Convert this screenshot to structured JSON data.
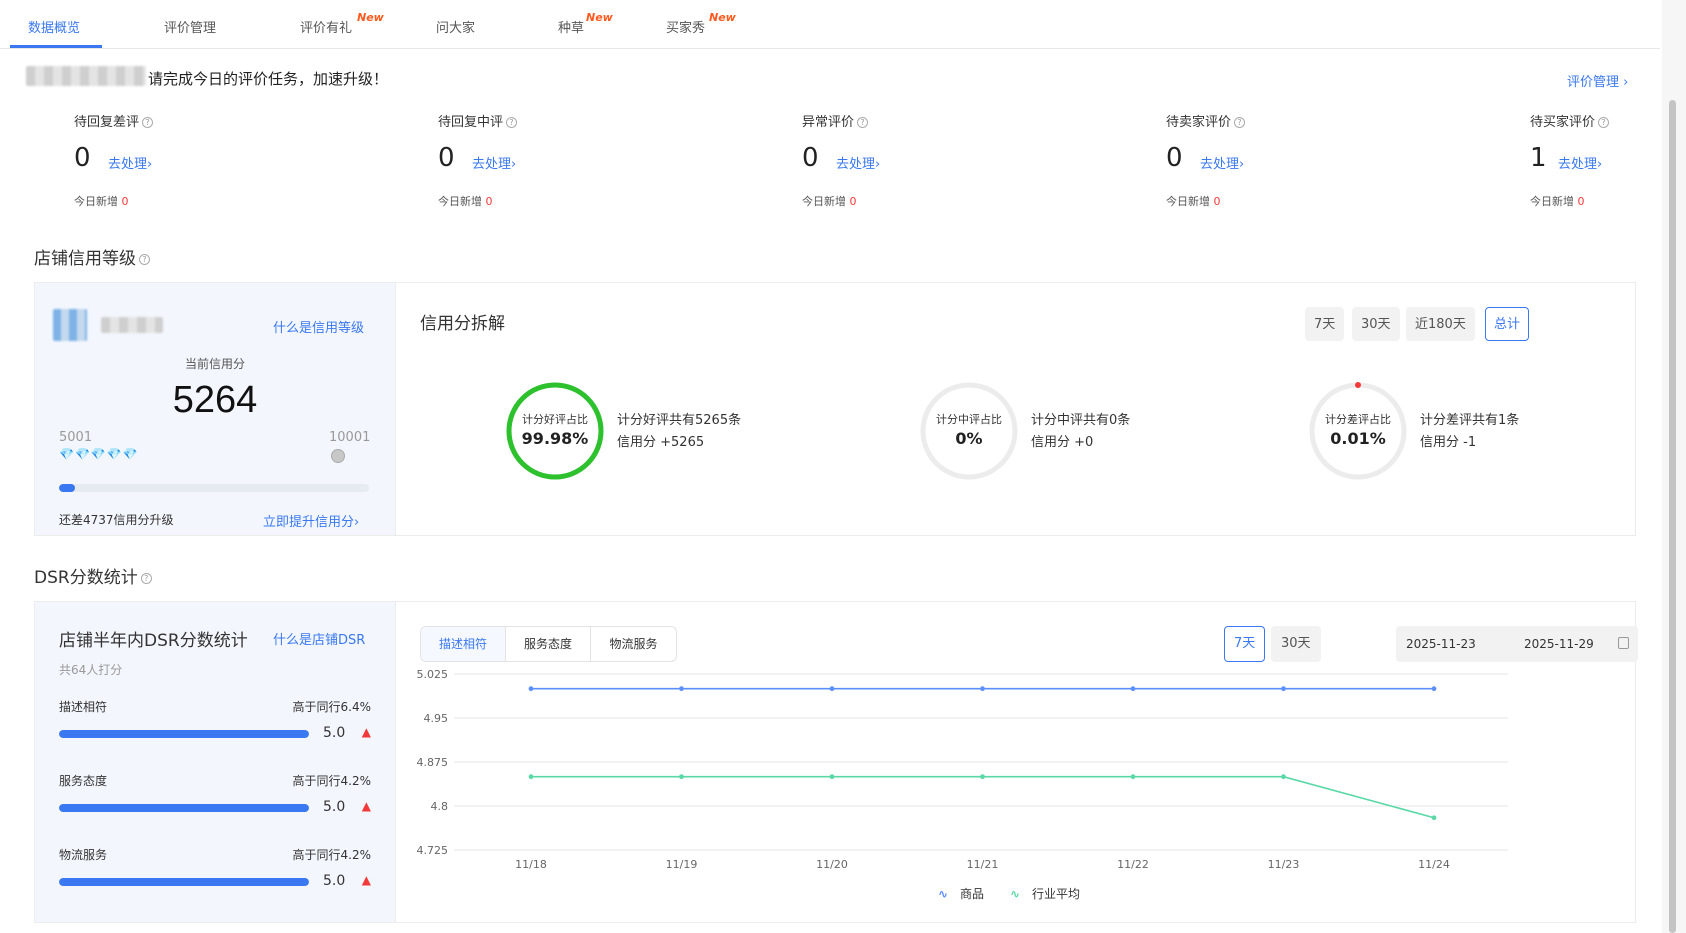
{
  "tabs": [
    {
      "label": "数据概览",
      "badge": ""
    },
    {
      "label": "评价管理",
      "badge": ""
    },
    {
      "label": "评价有礼",
      "badge": "New"
    },
    {
      "label": "问大家",
      "badge": ""
    },
    {
      "label": "种草",
      "badge": "New"
    },
    {
      "label": "买家秀",
      "badge": "New"
    }
  ],
  "notice": {
    "text": "请完成今日的评价任务，加速升级！",
    "review_manage_link": "评价管理 ›"
  },
  "metrics": [
    {
      "label": "待回复差评",
      "value": "0",
      "action": "去处理›",
      "new_label": "今日新增",
      "new_count": "0"
    },
    {
      "label": "待回复中评",
      "value": "0",
      "action": "去处理›",
      "new_label": "今日新增",
      "new_count": "0"
    },
    {
      "label": "异常评价",
      "value": "0",
      "action": "去处理›",
      "new_label": "今日新增",
      "new_count": "0"
    },
    {
      "label": "待卖家评价",
      "value": "0",
      "action": "去处理›",
      "new_label": "今日新增",
      "new_count": "0"
    },
    {
      "label": "待买家评价",
      "value": "1",
      "action": "去处理›",
      "new_label": "今日新增",
      "new_count": "0"
    }
  ],
  "credit": {
    "section_title": "店铺信用等级",
    "what_link": "什么是信用等级",
    "current_label": "当前信用分",
    "current_value": "5264",
    "range_min": "5001",
    "range_max": "10001",
    "level_icons": "💎💎💎💎💎",
    "progress_fraction": 0.0526,
    "gap_text": "还差4737信用分升级",
    "raise_link": "立即提升信用分›",
    "breakdown_title": "信用分拆解",
    "periods": [
      "7天",
      "30天",
      "近180天",
      "总计"
    ],
    "active_period": "总计",
    "rings": [
      {
        "caption": "计分好评占比",
        "percent": "99.98%",
        "fraction": 0.9998,
        "desc": "计分好评共有5265条",
        "score": "信用分 +5265",
        "color": "#2dc12d"
      },
      {
        "caption": "计分中评占比",
        "percent": "0%",
        "fraction": 0,
        "desc": "计分中评共有0条",
        "score": "信用分 +0",
        "color": "#f5a623"
      },
      {
        "caption": "计分差评占比",
        "percent": "0.01%",
        "fraction": 0.0001,
        "desc": "计分差评共有1条",
        "score": "信用分 -1",
        "color": "#f23a3a"
      }
    ]
  },
  "dsr": {
    "section_title": "DSR分数统计",
    "title": "店铺半年内DSR分数统计",
    "what_link": "什么是店铺DSR",
    "rater_count": "共64人打分",
    "rows": [
      {
        "name": "描述相符",
        "compare": "高于同行6.4%",
        "score": "5.0",
        "fraction": 1.0
      },
      {
        "name": "服务态度",
        "compare": "高于同行4.2%",
        "score": "5.0",
        "fraction": 1.0
      },
      {
        "name": "物流服务",
        "compare": "高于同行4.2%",
        "score": "5.0",
        "fraction": 1.0
      }
    ],
    "segments": [
      "描述相符",
      "服务态度",
      "物流服务"
    ],
    "active_segment": "描述相符",
    "periods": [
      "7天",
      "30天"
    ],
    "active_period": "7天",
    "date_start": "2025-11-23",
    "date_end": "2025-11-29"
  },
  "chart_data": {
    "type": "line",
    "x": [
      "11/18",
      "11/19",
      "11/20",
      "11/21",
      "11/22",
      "11/23",
      "11/24"
    ],
    "ylim": [
      4.725,
      5.025
    ],
    "yticks": [
      "5.025",
      "4.95",
      "4.875",
      "4.8",
      "4.725"
    ],
    "grid": true,
    "legend_position": "bottom",
    "series": [
      {
        "name": "商品",
        "color": "#5b8ff9",
        "values": [
          5.0,
          5.0,
          5.0,
          5.0,
          5.0,
          5.0,
          5.0
        ]
      },
      {
        "name": "行业平均",
        "color": "#5ad8a6",
        "values": [
          4.85,
          4.85,
          4.85,
          4.85,
          4.85,
          4.85,
          4.78
        ]
      }
    ]
  }
}
